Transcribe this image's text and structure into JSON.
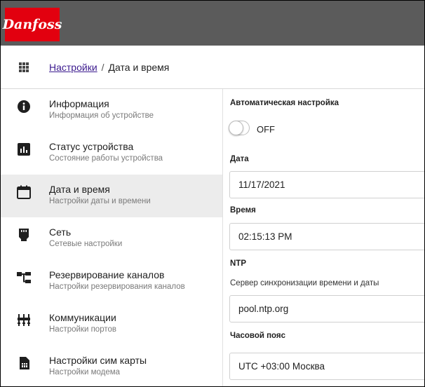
{
  "brand": {
    "logo_text": "Danfoss",
    "brand_color": "#e2000f",
    "topbar_color": "#5b5b5b"
  },
  "breadcrumb": {
    "parent": "Настройки",
    "separator": "/",
    "current": "Дата и время"
  },
  "sidebar": {
    "items": [
      {
        "title": "Информация",
        "subtitle": "Информация об устройстве",
        "icon": "info-icon"
      },
      {
        "title": "Статус устройства",
        "subtitle": "Состояние работы устройства",
        "icon": "bar-chart-icon"
      },
      {
        "title": "Дата и время",
        "subtitle": "Настройки даты и времени",
        "icon": "calendar-icon",
        "active": true
      },
      {
        "title": "Сеть",
        "subtitle": "Сетевые настройки",
        "icon": "ethernet-icon"
      },
      {
        "title": "Резервирование каналов",
        "subtitle": "Настройки резервирования каналов",
        "icon": "hierarchy-icon"
      },
      {
        "title": "Коммуникации",
        "subtitle": "Настройки портов",
        "icon": "ports-icon"
      },
      {
        "title": "Настройки сим карты",
        "subtitle": "Настройки модема",
        "icon": "sim-card-icon"
      }
    ]
  },
  "form": {
    "auto_setup_label": "Автоматическая настройка",
    "auto_setup_state": "OFF",
    "date_label": "Дата",
    "date_value": "11/17/2021",
    "time_label": "Время",
    "time_value": "02:15:13 PM",
    "ntp_label": "NTP",
    "ntp_server_label": "Сервер синхронизации времени и даты",
    "ntp_server_value": "pool.ntp.org",
    "timezone_label": "Часовой пояс",
    "timezone_value": "UTC +03:00 Москва"
  }
}
